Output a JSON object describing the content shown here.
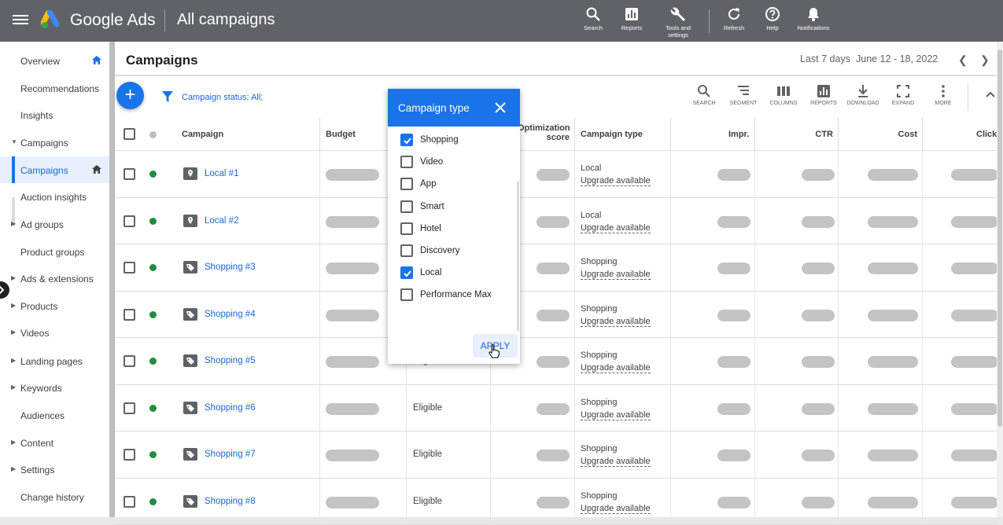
{
  "topbar": {
    "app_name": "Google Ads",
    "page_name": "All campaigns",
    "tools": [
      {
        "icon": "search-icon",
        "label": "Search"
      },
      {
        "icon": "reports-icon",
        "label": "Reports"
      },
      {
        "icon": "wrench-icon",
        "label": "Tools and settings"
      },
      {
        "icon": "refresh-icon",
        "label": "Refresh"
      },
      {
        "icon": "help-icon",
        "label": "Help"
      },
      {
        "icon": "bell-icon",
        "label": "Notifications"
      }
    ]
  },
  "sidebar": {
    "items": [
      {
        "label": "Overview"
      },
      {
        "label": "Recommendations"
      },
      {
        "label": "Insights"
      },
      {
        "label": "Campaigns"
      },
      {
        "label": "Campaigns"
      },
      {
        "label": "Auction insights"
      },
      {
        "label": "Ad groups"
      },
      {
        "label": "Product groups"
      },
      {
        "label": "Ads & extensions"
      },
      {
        "label": "Products"
      },
      {
        "label": "Videos"
      },
      {
        "label": "Landing pages"
      },
      {
        "label": "Keywords"
      },
      {
        "label": "Audiences"
      },
      {
        "label": "Content"
      },
      {
        "label": "Settings"
      },
      {
        "label": "Change history"
      }
    ]
  },
  "main": {
    "title": "Campaigns",
    "date_label": "Last 7 days",
    "date_range": "June 12 - 18, 2022",
    "filter_label": "Campaign status:",
    "filter_value": "All;",
    "toolbar": [
      {
        "icon": "search-icon",
        "label": "SEARCH"
      },
      {
        "icon": "segment-icon",
        "label": "SEGMENT"
      },
      {
        "icon": "columns-icon",
        "label": "COLUMNS"
      },
      {
        "icon": "reports-icon",
        "label": "REPORTS"
      },
      {
        "icon": "download-icon",
        "label": "DOWNLOAD"
      },
      {
        "icon": "expand-icon",
        "label": "EXPAND"
      },
      {
        "icon": "more-icon",
        "label": "MORE"
      }
    ],
    "columns": {
      "campaign": "Campaign",
      "budget": "Budget",
      "opt_score_1": "Optimization",
      "opt_score_2": "score",
      "campaign_type": "Campaign type",
      "impr": "Impr.",
      "ctr": "CTR",
      "cost": "Cost",
      "clicks": "Clicks"
    },
    "rows": [
      {
        "name": "Local #1",
        "icon": "map-pin-icon",
        "status": "",
        "type": "Local",
        "upgrade": "Upgrade available"
      },
      {
        "name": "Local #2",
        "icon": "map-pin-icon",
        "status": "",
        "type": "Local",
        "upgrade": "Upgrade available"
      },
      {
        "name": "Shopping #3",
        "icon": "tag-icon",
        "status": "",
        "type": "Shopping",
        "upgrade": "Upgrade available"
      },
      {
        "name": "Shopping #4",
        "icon": "tag-icon",
        "status": "",
        "type": "Shopping",
        "upgrade": "Upgrade available"
      },
      {
        "name": "Shopping #5",
        "icon": "tag-icon",
        "status": "Eligible",
        "type": "Shopping",
        "upgrade": "Upgrade available"
      },
      {
        "name": "Shopping #6",
        "icon": "tag-icon",
        "status": "Eligible",
        "type": "Shopping",
        "upgrade": "Upgrade available"
      },
      {
        "name": "Shopping #7",
        "icon": "tag-icon",
        "status": "Eligible",
        "type": "Shopping",
        "upgrade": "Upgrade available"
      },
      {
        "name": "Shopping #8",
        "icon": "tag-icon",
        "status": "Eligible",
        "type": "Shopping",
        "upgrade": "Upgrade available"
      }
    ]
  },
  "dialog": {
    "title": "Campaign type",
    "options": [
      {
        "label": "Shopping",
        "checked": true
      },
      {
        "label": "Video",
        "checked": false
      },
      {
        "label": "App",
        "checked": false
      },
      {
        "label": "Smart",
        "checked": false
      },
      {
        "label": "Hotel",
        "checked": false
      },
      {
        "label": "Discovery",
        "checked": false
      },
      {
        "label": "Local",
        "checked": true
      },
      {
        "label": "Performance Max",
        "checked": false
      }
    ],
    "apply_label": "APPLY"
  },
  "colors": {
    "accent": "#1a73e8",
    "topbar": "#5f6368",
    "enabled_dot": "#1e8e3e"
  }
}
